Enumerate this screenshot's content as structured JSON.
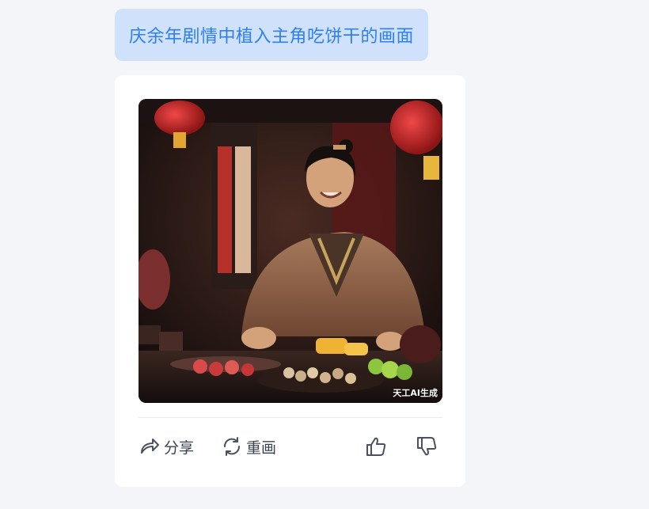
{
  "prompt": {
    "text": "庆余年剧情中植入主角吃饼干的画面"
  },
  "result": {
    "watermark": "天工AI生成",
    "image_description_icon": "generated-image"
  },
  "actions": {
    "share_label": "分享",
    "redraw_label": "重画",
    "like_icon": "thumbs-up-icon",
    "dislike_icon": "thumbs-down-icon"
  },
  "colors": {
    "accent": "#2f7ff0",
    "bubble_bg": "#cfe1fb",
    "page_bg": "#f4f5f8",
    "card_bg": "#ffffff"
  }
}
